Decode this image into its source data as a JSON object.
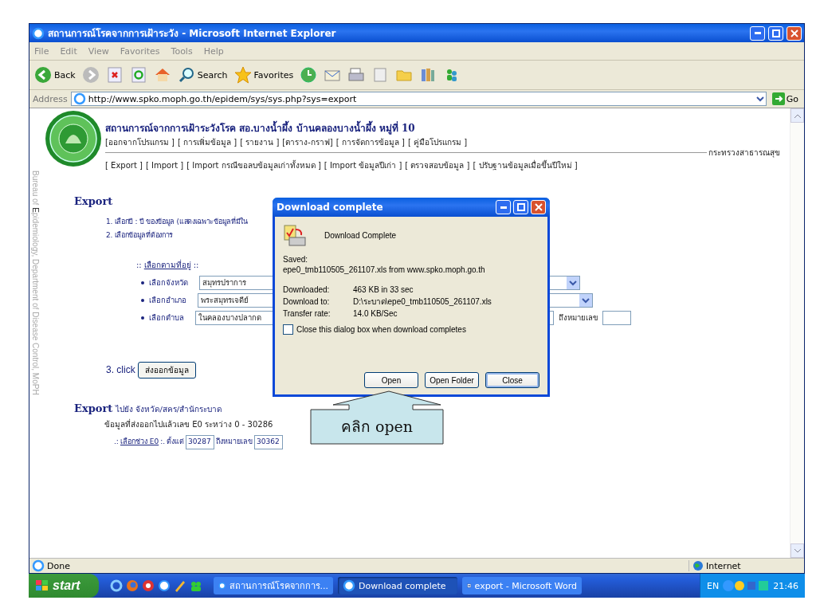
{
  "window": {
    "title": "สถานการณ์โรคจากการเฝ้าระวัง - Microsoft Internet Explorer"
  },
  "menu": [
    "File",
    "Edit",
    "View",
    "Favorites",
    "Tools",
    "Help"
  ],
  "toolbar": [
    {
      "kind": "back",
      "label": "Back"
    },
    {
      "kind": "forward"
    },
    {
      "kind": "stop"
    },
    {
      "kind": "refresh"
    },
    {
      "kind": "home"
    },
    {
      "kind": "search",
      "label": "Search"
    },
    {
      "kind": "favorites",
      "label": "Favorites"
    },
    {
      "kind": "history"
    },
    {
      "kind": "mail"
    },
    {
      "kind": "print"
    },
    {
      "kind": "edit"
    },
    {
      "kind": "folder"
    },
    {
      "kind": "research"
    },
    {
      "kind": "messenger"
    }
  ],
  "address": {
    "label": "Address",
    "url": "http://www.spko.moph.go.th/epidem/sys/sys.php?sys=export",
    "go": "Go"
  },
  "page": {
    "side_text": "Bureau of **E**pidemiology, Department of Disease Control, MoPH",
    "site_title": "สถานการณ์จากการเฝ้าระวังโรค สอ.บางน้ำผึ้ง บ้านคลองบางน้ำผึ้ง หมู่ที่ 10",
    "nav_1": [
      "[ออกจากโปรแกรม ]",
      "[ การเพิ่มข้อมูล ]",
      "[ รายงาน ]",
      "[ตาราง-กราฟ]",
      "[ การจัดการข้อมูล ]",
      "[ คู่มือโปรแกรม ]"
    ],
    "ministry": "กระทรวงสาธารณสุข",
    "nav_2": [
      "[ Export ]",
      "[ Import ]",
      "[ Import กรณีขอลบข้อมูลเก่าทั้งหมด ]",
      "[ Import ข้อมูลปีเก่า ]",
      "[ ตรวจสอบข้อมูล ]",
      "[ ปรับฐานข้อมูลเมื่อขึ้นปีใหม่ ]"
    ],
    "export": {
      "heading": "Export",
      "step_1": "1. เลือกปี : ปี ของข้อมูล (แสดงเฉพาะข้อมูลที่มีใน",
      "step_2": "2. เลือกข้อมูลที่ต้องการ",
      "filter": {
        "pre": "::",
        "link": "เลือกตามที่อยู่",
        "post": "::"
      },
      "rows": [
        {
          "label": "เลือกจังหวัด",
          "value": "สมุทรปราการ"
        },
        {
          "label": "เลือกอำเภอ",
          "value": "พระสมุทรเจดีย์"
        },
        {
          "label": "เลือกตำบล",
          "value": "ในคลองบางปลากด",
          "to_label": "ถึงหมายเลข"
        }
      ],
      "step_3": {
        "label": "3. click",
        "button": "ส่งออกข้อมูล"
      }
    },
    "export_2": {
      "heading": "Export",
      "heading_rest": "ไปยัง จังหวัด/สคร/สำนักระบาด",
      "summary": "ข้อมูลที่ส่งออกไปแล้วเลข E0 ระหว่าง 0 - 30286",
      "range": {
        "pre": ".:",
        "link": "เลือกช่วง E0",
        "post": ":.",
        "from_label": "ตั้งแต่",
        "from": "30287",
        "to_label": "ถึงหมายเลข",
        "to": "30362"
      }
    }
  },
  "dialog": {
    "title": "Download complete",
    "heading": "Download Complete",
    "saved_label": "Saved:",
    "saved": "epe0_tmb110505_261107.xls from www.spko.moph.go.th",
    "rows": [
      {
        "label": "Downloaded:",
        "value": "463 KB in 33 sec"
      },
      {
        "label": "Download to:",
        "value": "D:\\ระบาด\\epe0_tmb110505_261107.xls"
      },
      {
        "label": "Transfer rate:",
        "value": "14.0 KB/Sec"
      }
    ],
    "checkbox": {
      "label": "Close this dialog box when download completes",
      "checked": false
    },
    "buttons": [
      {
        "label": "Open",
        "default": false
      },
      {
        "label": "Open Folder",
        "default": false
      },
      {
        "label": "Close",
        "default": true
      }
    ]
  },
  "callout": "คลิก open",
  "status": {
    "text": "Done",
    "zone": "Internet"
  },
  "taskbar": {
    "start": "start",
    "tasks": [
      {
        "kind": "ie",
        "label": "สถานการณ์โรคจากการ...",
        "selected": false
      },
      {
        "kind": "ie",
        "label": "Download complete",
        "selected": true
      },
      {
        "kind": "word",
        "label": "export - Microsoft Word",
        "selected": false
      }
    ],
    "lang": "EN",
    "clock": "21:46"
  }
}
